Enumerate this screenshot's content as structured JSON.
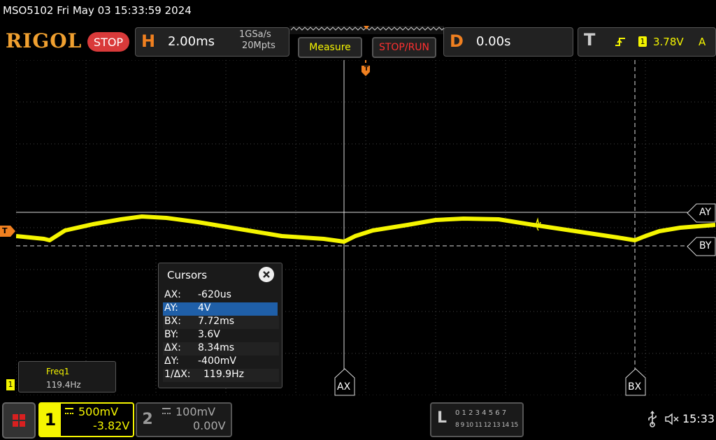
{
  "status_line": "MSO5102  Fri May 03 15:33:59 2024",
  "brand": {
    "logo": "RIGOL",
    "run_state": "STOP"
  },
  "horizontal": {
    "letter": "H",
    "timebase": "2.00ms",
    "sample_rate": "1GSa/s",
    "memory_depth": "20Mpts"
  },
  "buttons": {
    "measure": "Measure",
    "stop_run": "STOP/RUN"
  },
  "delay": {
    "letter": "D",
    "value": "0.00s"
  },
  "trigger": {
    "letter": "T",
    "channel": "1",
    "level": "3.78V",
    "mode": "A"
  },
  "markers": {
    "trigger_level": "T",
    "channel1_ground": "1",
    "trigger_pos": "T"
  },
  "cursor_labels": {
    "ax": "AX",
    "bx": "BX",
    "ay": "AY",
    "by": "BY"
  },
  "cursors_panel": {
    "title": "Cursors",
    "rows": [
      {
        "label": "AX:",
        "value": "-620us"
      },
      {
        "label": "AY:",
        "value": "4V"
      },
      {
        "label": "BX:",
        "value": "7.72ms"
      },
      {
        "label": "BY:",
        "value": "3.6V"
      },
      {
        "label": "ΔX:",
        "value": "8.34ms"
      },
      {
        "label": "ΔY:",
        "value": "-400mV"
      },
      {
        "label": "1/ΔX:",
        "value": "119.9Hz"
      }
    ],
    "selected_index": 1
  },
  "measurement": {
    "name": "Freq1",
    "value": "119.4Hz"
  },
  "channel1": {
    "number": "1",
    "scale": "500mV",
    "offset": "-3.82V",
    "color": "#f5f500"
  },
  "channel2": {
    "number": "2",
    "scale": "100mV",
    "offset": "0.00V"
  },
  "logic": {
    "letter": "L",
    "row1": "0 1 2 3  4 5 6 7",
    "row2": "8 9 10 11 12 13 14 15"
  },
  "clock": "15:33",
  "colors": {
    "accent": "#f08020",
    "trace": "#f5f500",
    "selected_row": "#1f5fa8",
    "stop_red": "#d93a3a"
  },
  "icons": {
    "menu": "grid-menu-icon",
    "usb": "usb-icon",
    "sound": "speaker-muted-icon",
    "close": "close-icon"
  }
}
